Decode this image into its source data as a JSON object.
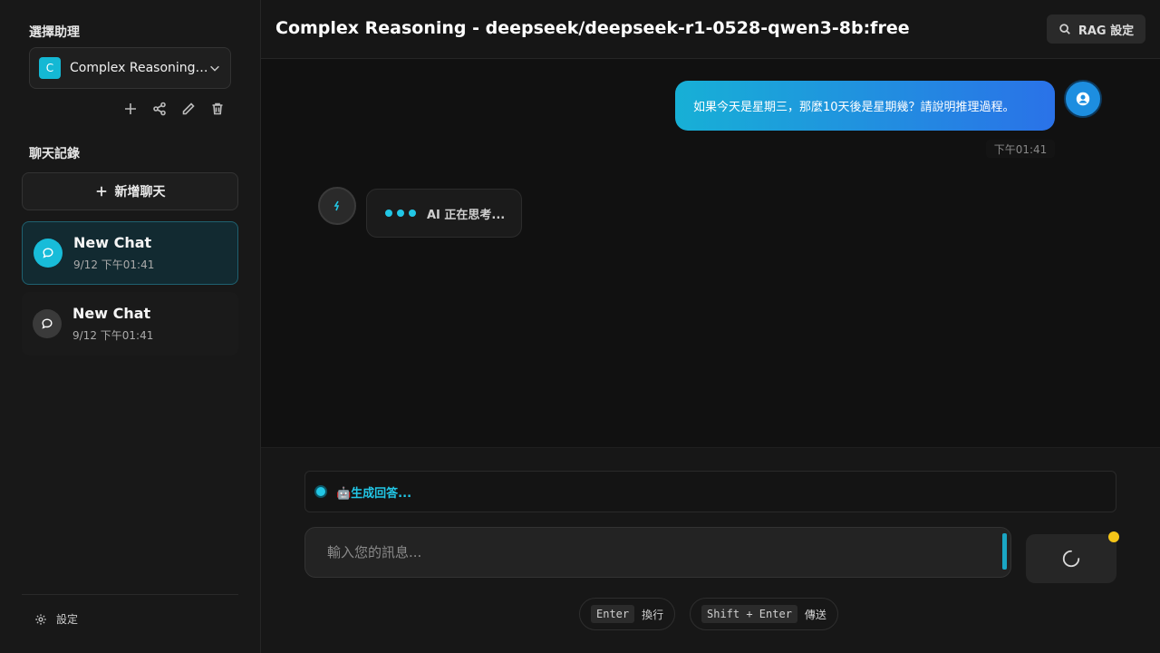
{
  "sidebar": {
    "assistant_section_title": "選擇助理",
    "assistant": {
      "badge": "C",
      "name": "Complex Reasoning - deepseek/deepseek-r1-0528-qwen3-8b:free"
    },
    "history_section_title": "聊天記錄",
    "new_chat_label": "新增聊天",
    "chats": [
      {
        "title": "New Chat",
        "time": "9/12 下午01:41",
        "active": true
      },
      {
        "title": "New Chat",
        "time": "9/12 下午01:41",
        "active": false
      }
    ],
    "settings_label": "設定"
  },
  "header": {
    "title": "Complex Reasoning - deepseek/deepseek-r1-0528-qwen3-8b:free",
    "rag_button_label": "RAG 設定"
  },
  "conversation": {
    "user_message": "如果今天是星期三，那麼10天後是星期幾？請說明推理過程。",
    "user_message_time": "下午01:41",
    "ai_status": "AI 正在思考..."
  },
  "composer": {
    "status_text": "🤖生成回答...",
    "input_placeholder": "輸入您的訊息...",
    "hints": [
      {
        "key": "Enter",
        "label": "換行"
      },
      {
        "key": "Shift + Enter",
        "label": "傳送"
      }
    ]
  },
  "colors": {
    "accent": "#22c7e6",
    "user_bubble_start": "#17b0d6",
    "user_bubble_end": "#2a72e8",
    "status_indicator": "#f5c518"
  }
}
